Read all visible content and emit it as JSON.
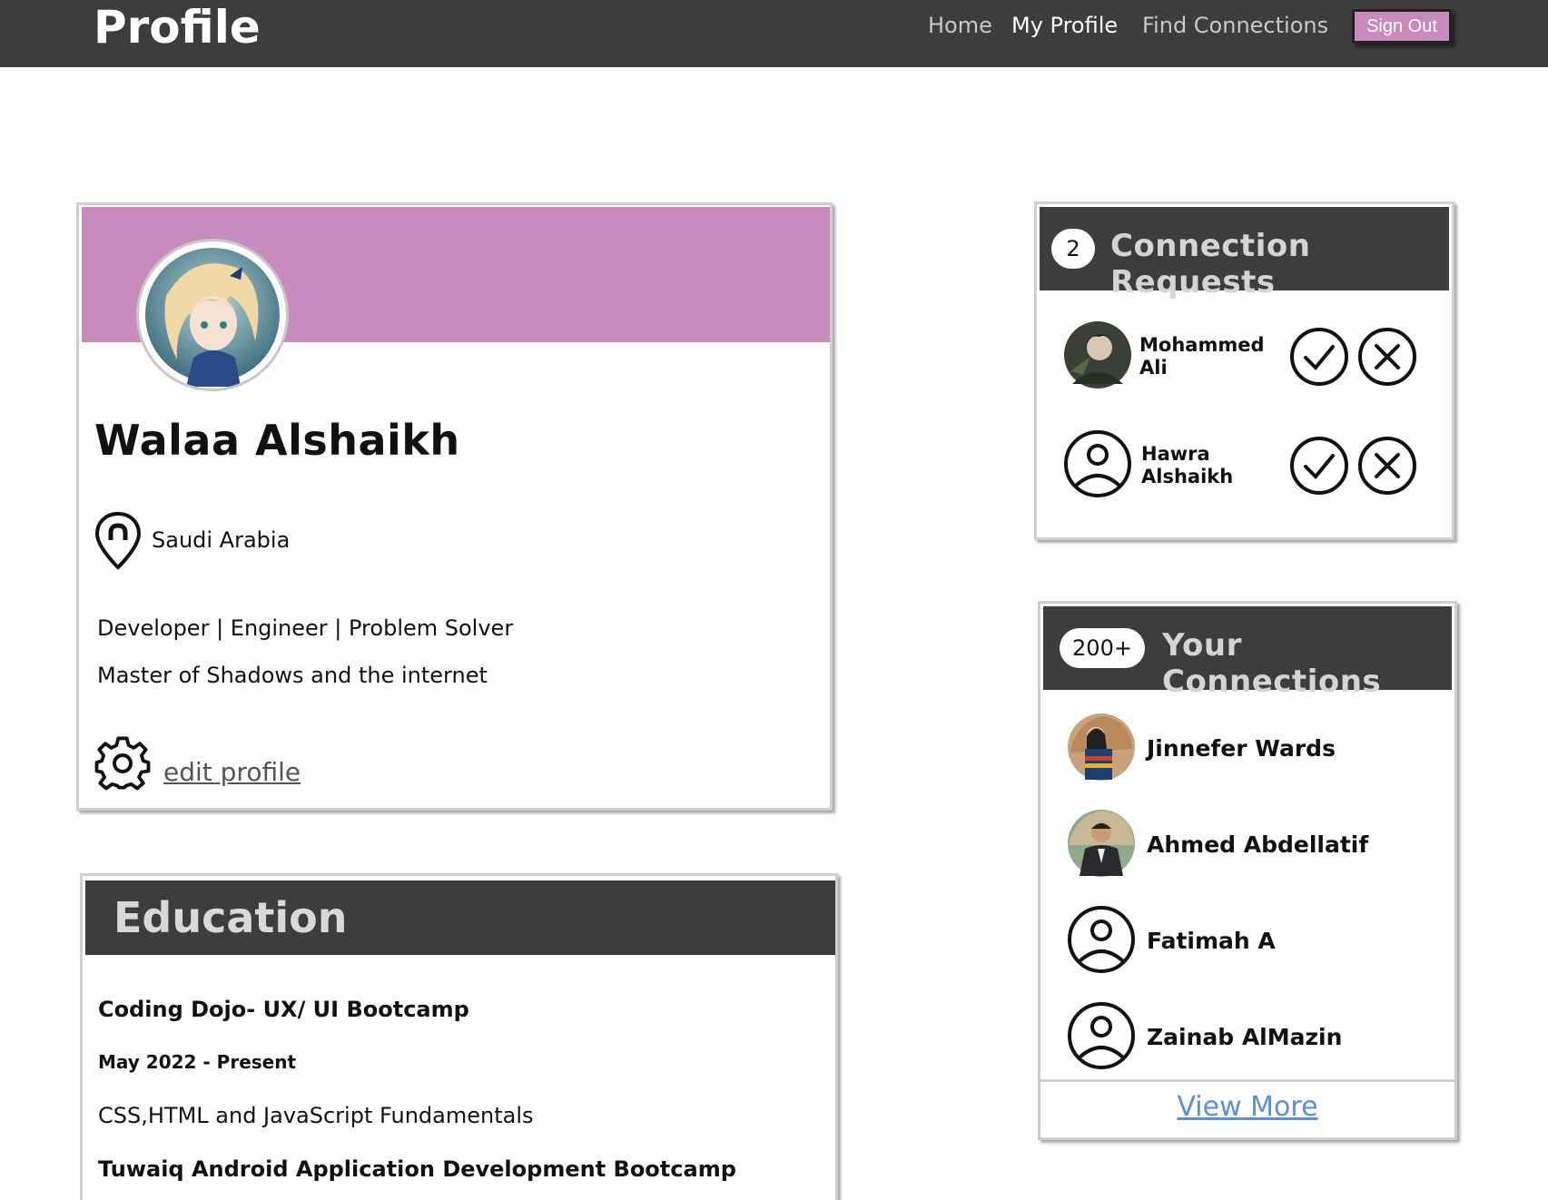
{
  "brand": {
    "title": "Profile"
  },
  "nav": {
    "home": "Home",
    "my_profile": "My Profile",
    "find_connections": "Find Connections",
    "sign_out": "Sign Out",
    "active": "My Profile"
  },
  "colors": {
    "accent": "#c98abd",
    "header_dark": "#3d3d3d",
    "link_blue": "#5b8fd6"
  },
  "profile": {
    "name": "Walaa Alshaikh",
    "location": "Saudi Arabia",
    "bio_line1": "Developer | Engineer | Problem Solver",
    "bio_line2": "Master of Shadows and the internet",
    "edit_label": "edit profile",
    "avatar": "anime-character-avatar"
  },
  "education": {
    "title": "Education",
    "items": [
      {
        "school": "Coding Dojo- UX/ UI Bootcamp",
        "dates": "May 2022 - Present",
        "description": "CSS,HTML and JavaScript Fundamentals"
      },
      {
        "school": "Tuwaiq Android Application Development Bootcamp"
      }
    ]
  },
  "requests": {
    "count": "2",
    "title": "Connection Requests",
    "people": [
      {
        "first": "Mohammed",
        "last": "Ali",
        "avatar": "photo"
      },
      {
        "first": "Hawra",
        "last": "Alshaikh",
        "avatar": "user-placeholder-icon"
      }
    ]
  },
  "connections": {
    "count": "200+",
    "title": "Your Connections",
    "people": [
      {
        "name": "Jinnefer Wards",
        "avatar": "photo"
      },
      {
        "name": "Ahmed Abdellatif",
        "avatar": "photo"
      },
      {
        "name": "Fatimah A",
        "avatar": "user-placeholder-icon"
      },
      {
        "name": "Zainab AlMazin",
        "avatar": "user-placeholder-icon"
      }
    ],
    "view_more": "View More"
  }
}
